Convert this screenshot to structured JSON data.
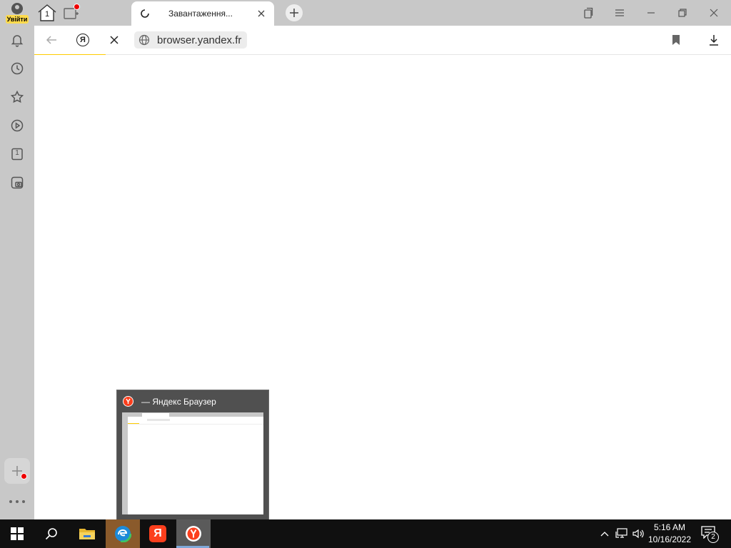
{
  "sidebar": {
    "profile_login_label": "Увійти",
    "items": [
      {
        "icon": "bell-icon"
      },
      {
        "icon": "history-clock-icon"
      },
      {
        "icon": "star-icon"
      },
      {
        "icon": "play-icon"
      },
      {
        "icon": "tab-counter-icon",
        "label": "1"
      },
      {
        "icon": "screenshot-camera-icon"
      }
    ],
    "add_panel_icon": "plus-icon",
    "more_icon": "more-dots-icon"
  },
  "tabbar": {
    "home_tab_count": "1",
    "active_tab": {
      "title": "Завантаження..."
    },
    "new_tab_icon": "plus-icon"
  },
  "toolbar": {
    "yandex_letter": "Я",
    "url": "browser.yandex.fr"
  },
  "taskbar_preview": {
    "title": "— Яндекс Браузер"
  },
  "taskbar": {
    "apps": [
      {
        "name": "start-button"
      },
      {
        "name": "search-button"
      },
      {
        "name": "file-explorer"
      },
      {
        "name": "microsoft-edge"
      },
      {
        "name": "yandex-app",
        "letter": "Я"
      },
      {
        "name": "yandex-browser"
      }
    ],
    "time": "5:16 AM",
    "date": "10/16/2022",
    "notification_count": "2"
  },
  "colors": {
    "sidebar_bg": "#c8c8c8",
    "accent_yellow": "#ffcc00",
    "login_badge": "#ffdb4d",
    "taskbar_bg": "#101010",
    "notification_dot": "#e00000",
    "yandex_red": "#fc3f1d"
  }
}
